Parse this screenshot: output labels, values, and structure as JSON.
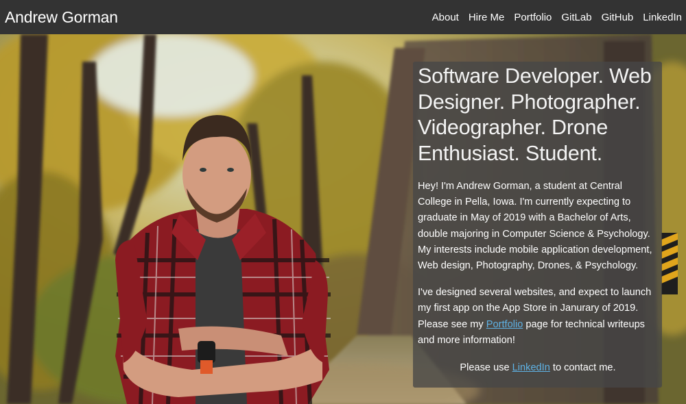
{
  "navbar": {
    "brand": "Andrew Gorman",
    "links": [
      "About",
      "Hire Me",
      "Portfolio",
      "GitLab",
      "GitHub",
      "LinkedIn"
    ]
  },
  "hero": {
    "headline": "Software Developer. Web Designer. Photographer. Videographer. Drone Enthusiast. Student.",
    "intro": "Hey! I'm Andrew Gorman, a student at Central College in Pella, Iowa. I'm currently expecting to graduate in May of 2019 with a Bachelor of Arts, double majoring in Computer Science & Psychology. My interests include mobile application development, Web design, Photography, Drones, & Psychology.",
    "websites_before": "I've designed several websites, and expect to launch my first app on the App Store in Janurary of 2019. Please see my ",
    "portfolio_link": "Portfolio",
    "websites_after": " page for technical writeups and more information!",
    "contact_before": "Please use ",
    "contact_link": "LinkedIn",
    "contact_after": " to contact me."
  },
  "colors": {
    "navbar_bg": "#333333",
    "link_accent": "#5fb3e6"
  }
}
